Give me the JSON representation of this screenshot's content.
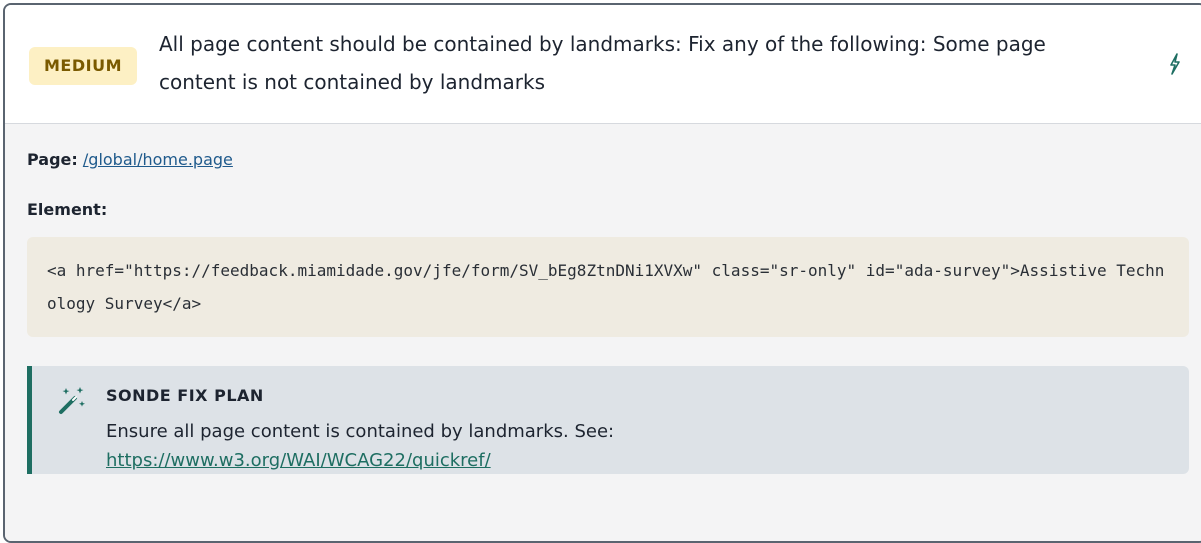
{
  "issue": {
    "severity": "MEDIUM",
    "title": "All page content should be contained by landmarks: Fix any of the following: Some page content is not contained by landmarks",
    "toggle_icon": "lightning-icon"
  },
  "details": {
    "page_label": "Page:",
    "page_value": "/global/home.page",
    "element_label": "Element:",
    "element_code": "<a href=\"https://feedback.miamidade.gov/jfe/form/SV_bEg8ZtnDNi1XVXw\" class=\"sr-only\" id=\"ada-survey\">Assistive Technology Survey</a>"
  },
  "fix_plan": {
    "icon": "magic-wand-icon",
    "heading": "SONDE FIX PLAN",
    "text": "Ensure all page content is contained by landmarks. See:",
    "link": "https://www.w3.org/WAI/WCAG22/quickref/"
  },
  "colors": {
    "badge_bg": "#fdf0c4",
    "badge_text": "#7a5a00",
    "accent": "#1e6e62",
    "code_bg": "#efebe1",
    "fix_bg": "#dde2e7"
  }
}
